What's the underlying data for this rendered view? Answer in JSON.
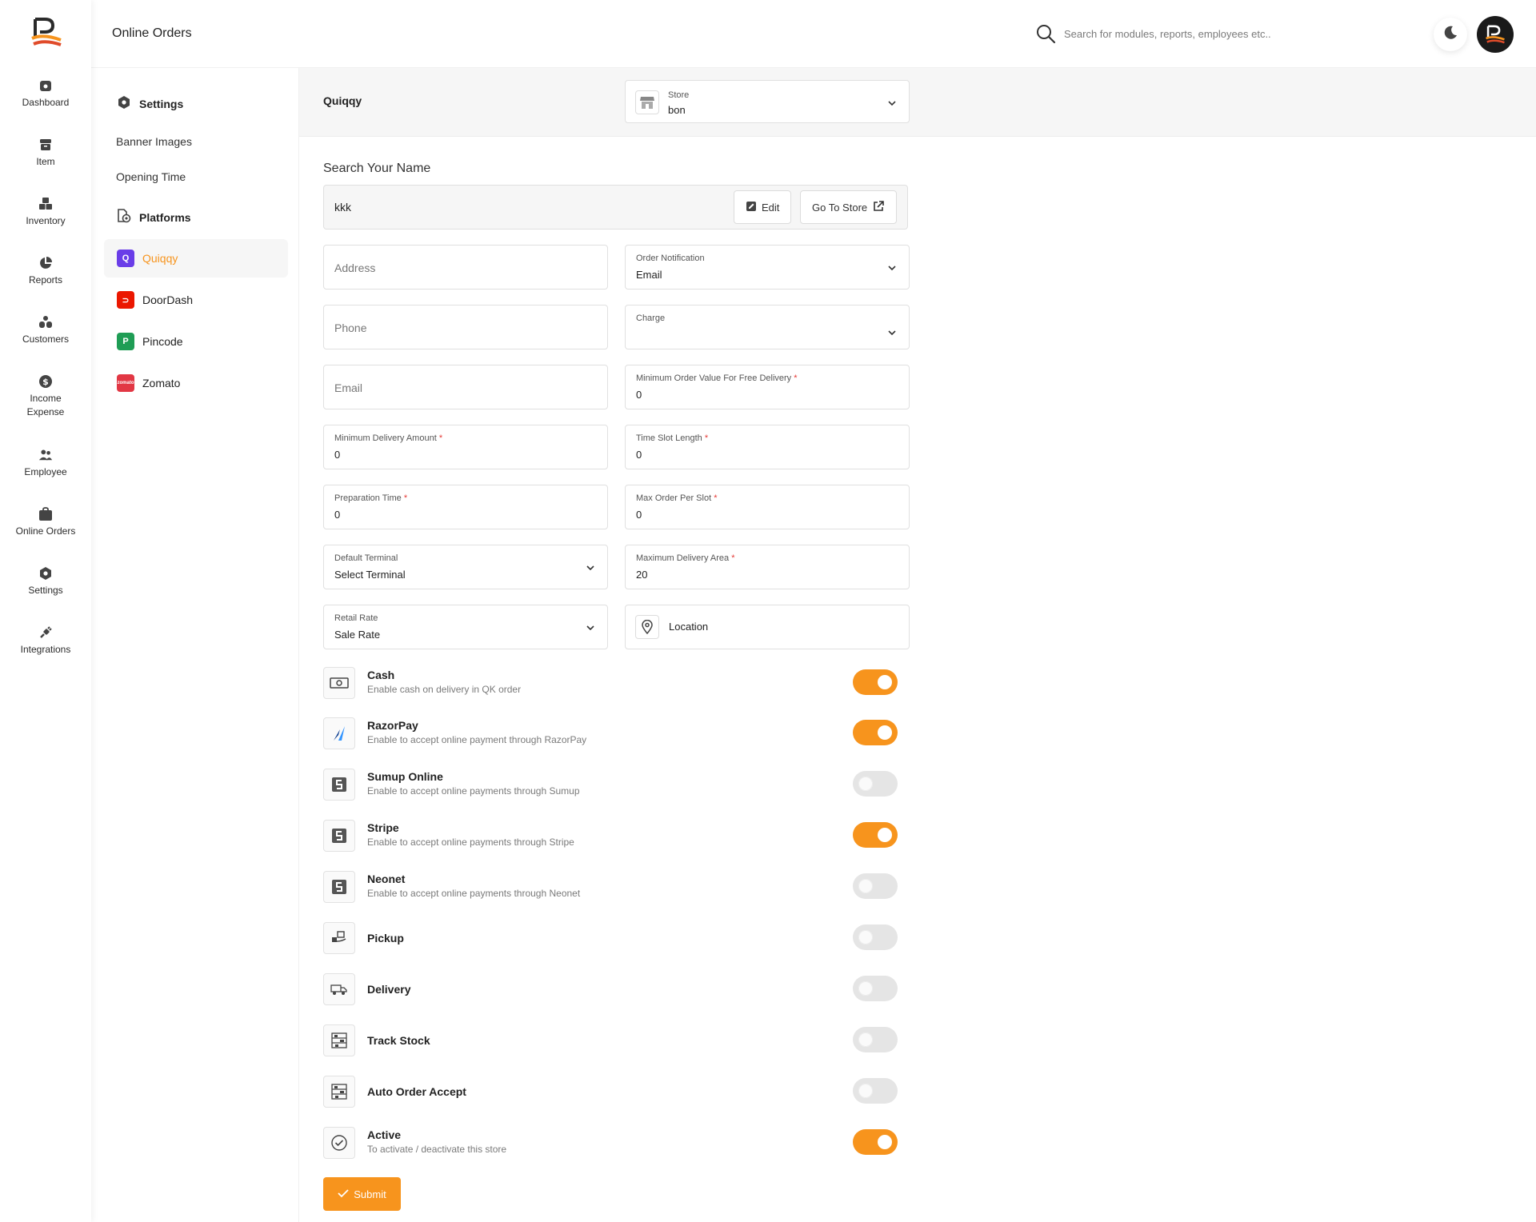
{
  "header": {
    "page_title": "Online Orders",
    "search_placeholder": "Search for modules, reports, employees etc.."
  },
  "rail": {
    "items": [
      {
        "label": "Dashboard",
        "icon": "dashboard-icon"
      },
      {
        "label": "Item",
        "icon": "item-icon"
      },
      {
        "label": "Inventory",
        "icon": "inventory-icon"
      },
      {
        "label": "Reports",
        "icon": "reports-icon"
      },
      {
        "label": "Customers",
        "icon": "customers-icon"
      },
      {
        "label": "Income Expense",
        "icon": "income-expense-icon"
      },
      {
        "label": "Employee",
        "icon": "employee-icon"
      },
      {
        "label": "Online Orders",
        "icon": "online-orders-icon"
      },
      {
        "label": "Settings",
        "icon": "settings-icon"
      },
      {
        "label": "Integrations",
        "icon": "integrations-icon"
      }
    ]
  },
  "subnav": {
    "settings_heading": "Settings",
    "links": [
      "Banner Images",
      "Opening Time"
    ],
    "platforms_heading": "Platforms",
    "platforms": [
      {
        "label": "Quiqqy",
        "color": "#6a3de8",
        "active": true
      },
      {
        "label": "DoorDash",
        "color": "#eb1700",
        "active": false
      },
      {
        "label": "Pincode",
        "color": "#1f9d55",
        "active": false
      },
      {
        "label": "Zomato",
        "color": "#e23744",
        "active": false
      }
    ]
  },
  "store_bar": {
    "brand": "Quiqqy",
    "store_label": "Store",
    "store_value": "bon"
  },
  "form": {
    "section_title": "Search Your Name",
    "name_value": "kkk",
    "edit_label": "Edit",
    "go_to_store_label": "Go To Store",
    "address_placeholder": "Address",
    "phone_placeholder": "Phone",
    "email_placeholder": "Email",
    "order_notification": {
      "label": "Order Notification",
      "value": "Email"
    },
    "charge": {
      "label": "Charge",
      "value": ""
    },
    "min_order_free_delivery": {
      "label": "Minimum Order Value For Free Delivery",
      "value": "0"
    },
    "min_delivery_amount": {
      "label": "Minimum Delivery Amount",
      "value": "0"
    },
    "time_slot_length": {
      "label": "Time Slot Length",
      "value": "0"
    },
    "preparation_time": {
      "label": "Preparation Time",
      "value": "0"
    },
    "max_order_per_slot": {
      "label": "Max Order Per Slot",
      "value": "0"
    },
    "default_terminal": {
      "label": "Default Terminal",
      "value": "Select Terminal"
    },
    "max_delivery_area": {
      "label": "Maximum Delivery Area",
      "value": "20"
    },
    "retail_rate": {
      "label": "Retail Rate",
      "value": "Sale Rate"
    },
    "location_label": "Location",
    "required_mark": "*"
  },
  "toggles": [
    {
      "title": "Cash",
      "desc": "Enable cash on delivery in QK order",
      "on": true,
      "icon": "cash-icon"
    },
    {
      "title": "RazorPay",
      "desc": "Enable to accept online payment through RazorPay",
      "on": true,
      "icon": "razorpay-icon"
    },
    {
      "title": "Sumup Online",
      "desc": "Enable to accept online payments through Sumup",
      "on": false,
      "icon": "sumup-icon"
    },
    {
      "title": "Stripe",
      "desc": "Enable to accept online payments through Stripe",
      "on": true,
      "icon": "stripe-icon"
    },
    {
      "title": "Neonet",
      "desc": "Enable to accept online payments through Neonet",
      "on": false,
      "icon": "neonet-icon"
    },
    {
      "title": "Pickup",
      "desc": "",
      "on": false,
      "icon": "pickup-icon"
    },
    {
      "title": "Delivery",
      "desc": "",
      "on": false,
      "icon": "delivery-icon"
    },
    {
      "title": "Track Stock",
      "desc": "",
      "on": false,
      "icon": "track-stock-icon"
    },
    {
      "title": "Auto Order Accept",
      "desc": "",
      "on": false,
      "icon": "auto-order-accept-icon"
    },
    {
      "title": "Active",
      "desc": "To activate / deactivate this store",
      "on": true,
      "icon": "check-circle-icon"
    }
  ],
  "submit_label": "Submit",
  "colors": {
    "accent": "#f7941d",
    "toggle_off": "#e5e5e5"
  }
}
